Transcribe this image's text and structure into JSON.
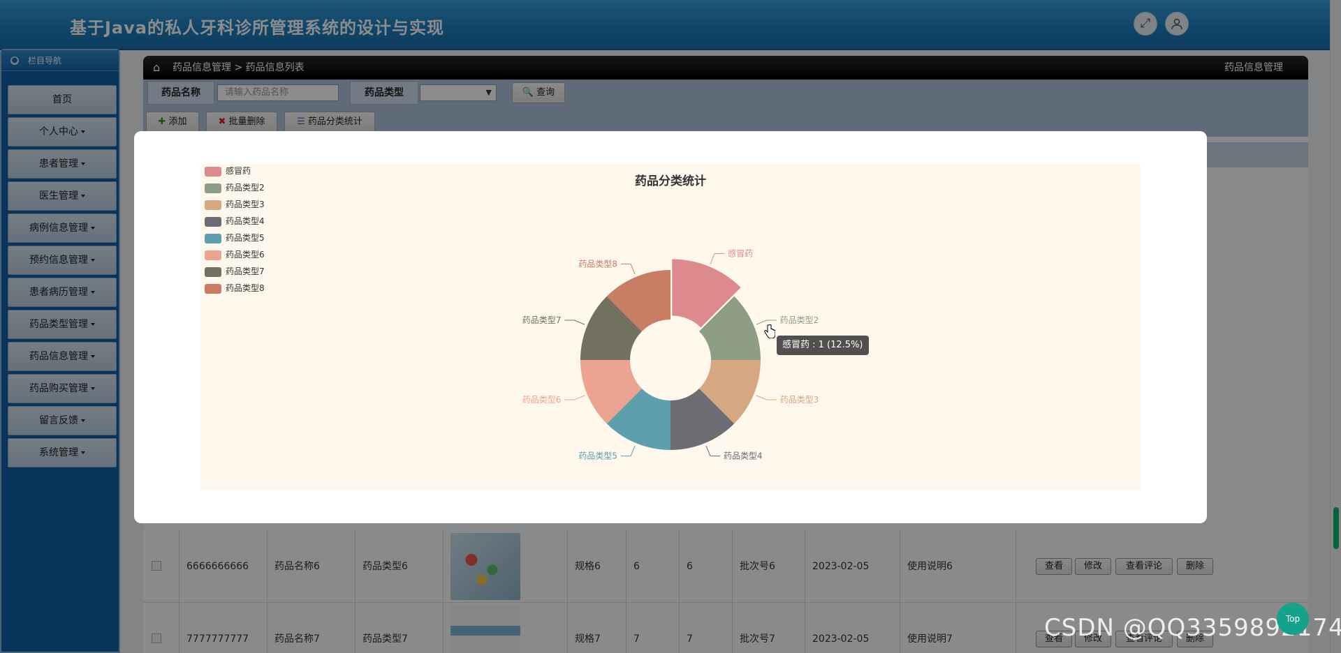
{
  "header": {
    "title": "基于Java的私人牙科诊所管理系统的设计与实现",
    "fullscreen_icon": "⤢",
    "user_icon": "👤"
  },
  "sidebar": {
    "heading": "栏目导航",
    "items": [
      {
        "label": "首页",
        "has_caret": false
      },
      {
        "label": "个人中心",
        "has_caret": true
      },
      {
        "label": "患者管理",
        "has_caret": true
      },
      {
        "label": "医生管理",
        "has_caret": true
      },
      {
        "label": "病例信息管理",
        "has_caret": true
      },
      {
        "label": "预约信息管理",
        "has_caret": true
      },
      {
        "label": "患者病历管理",
        "has_caret": true
      },
      {
        "label": "药品类型管理",
        "has_caret": true
      },
      {
        "label": "药品信息管理",
        "has_caret": true
      },
      {
        "label": "药品购买管理",
        "has_caret": true
      },
      {
        "label": "留言反馈",
        "has_caret": true
      },
      {
        "label": "系统管理",
        "has_caret": true
      }
    ]
  },
  "breadcrumb": {
    "path": "药品信息管理 > 药品信息列表",
    "right": "药品信息管理"
  },
  "search": {
    "name_label": "药品名称",
    "name_placeholder": "请输入药品名称",
    "type_label": "药品类型",
    "type_value": "",
    "query_label": "查询",
    "add_label": "添加",
    "batch_delete_label": "批量删除",
    "stats_label": "药品分类统计"
  },
  "table": {
    "rows": [
      {
        "code": "6666666666",
        "name": "药品名称6",
        "type": "药品类型6",
        "spec": "规格6",
        "a": "6",
        "b": "6",
        "batch": "批次号6",
        "date": "2023-02-05",
        "usage": "使用说明6"
      },
      {
        "code": "7777777777",
        "name": "药品名称7",
        "type": "药品类型7",
        "spec": "规格7",
        "a": "7",
        "b": "7",
        "batch": "批次号7",
        "date": "2023-02-05",
        "usage": "使用说明7"
      }
    ],
    "actions": [
      "查看",
      "修改",
      "查看评论",
      "删除"
    ]
  },
  "chart_data": {
    "type": "pie",
    "title": "药品分类统计",
    "categories": [
      "感冒药",
      "药品类型2",
      "药品类型3",
      "药品类型4",
      "药品类型5",
      "药品类型6",
      "药品类型7",
      "药品类型8"
    ],
    "values": [
      1,
      1,
      1,
      1,
      1,
      1,
      1,
      1
    ],
    "colors": [
      "#dd8a8f",
      "#8e9e85",
      "#d6a882",
      "#6d6c73",
      "#5e9fad",
      "#eda391",
      "#72705f",
      "#c97e64"
    ],
    "legend_position": "top-left",
    "donut": true,
    "highlighted": "感冒药",
    "tooltip": "感冒药 : 1 (12.5%)"
  },
  "watermark": "CSDN @QQ3359892174",
  "top_button": "Top"
}
